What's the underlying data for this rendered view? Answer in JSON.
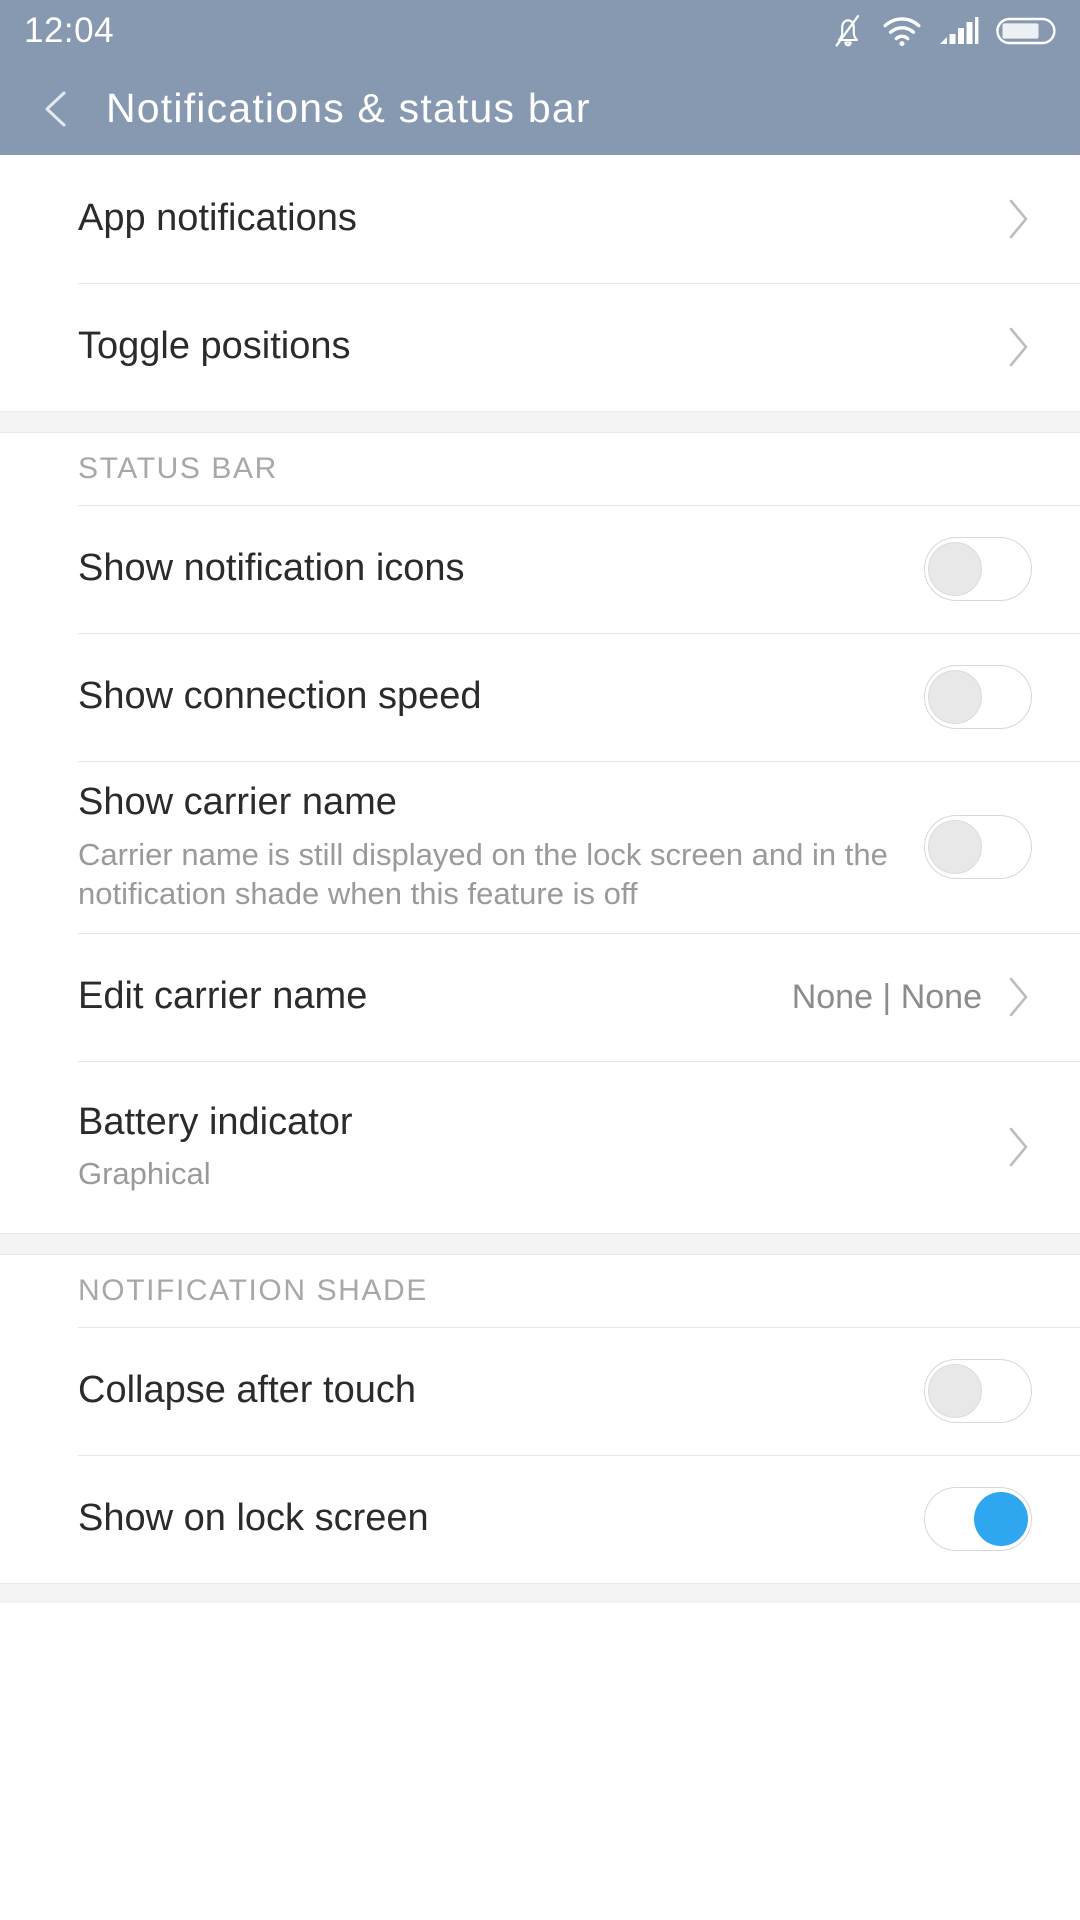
{
  "status_bar": {
    "time": "12:04",
    "icons": [
      "bell-slash-icon",
      "wifi-icon",
      "signal-icon",
      "battery-icon"
    ],
    "battery_level_percent": 68,
    "signal_bars": 4,
    "wifi_bars": 3
  },
  "header": {
    "title": "Notifications & status bar",
    "back_icon": "chevron-left-icon",
    "background_color": "#8699b0"
  },
  "colors": {
    "accent": "#2ea7f0",
    "divider": "#e6e6e6",
    "section_band": "#f4f4f4",
    "title_text": "#2b2b2b",
    "secondary_text": "#9a9a9a"
  },
  "list": [
    {
      "kind": "nav",
      "name": "app-notifications",
      "title": "App notifications",
      "chevron": "chevron-right-icon",
      "first": true
    },
    {
      "kind": "nav",
      "name": "toggle-positions",
      "title": "Toggle positions",
      "chevron": "chevron-right-icon"
    },
    {
      "kind": "section",
      "name": "status-bar",
      "label": "STATUS BAR"
    },
    {
      "kind": "toggle",
      "name": "show-notification-icons",
      "title": "Show notification icons",
      "state": "off"
    },
    {
      "kind": "toggle",
      "name": "show-connection-speed",
      "title": "Show connection speed",
      "state": "off"
    },
    {
      "kind": "toggle",
      "name": "show-carrier-name",
      "title": "Show carrier name",
      "subtitle": "Carrier name is still displayed on the lock screen and in the notification shade when this feature is off",
      "state": "off"
    },
    {
      "kind": "value",
      "name": "edit-carrier-name",
      "title": "Edit carrier name",
      "value": "None | None",
      "chevron": "chevron-right-icon"
    },
    {
      "kind": "nav-sub",
      "name": "battery-indicator",
      "title": "Battery indicator",
      "subtitle": "Graphical",
      "chevron": "chevron-right-icon"
    },
    {
      "kind": "section",
      "name": "notification-shade",
      "label": "NOTIFICATION SHADE"
    },
    {
      "kind": "toggle",
      "name": "collapse-after-touch",
      "title": "Collapse after touch",
      "state": "off"
    },
    {
      "kind": "toggle",
      "name": "show-on-lock-screen",
      "title": "Show on lock screen",
      "state": "on"
    }
  ]
}
